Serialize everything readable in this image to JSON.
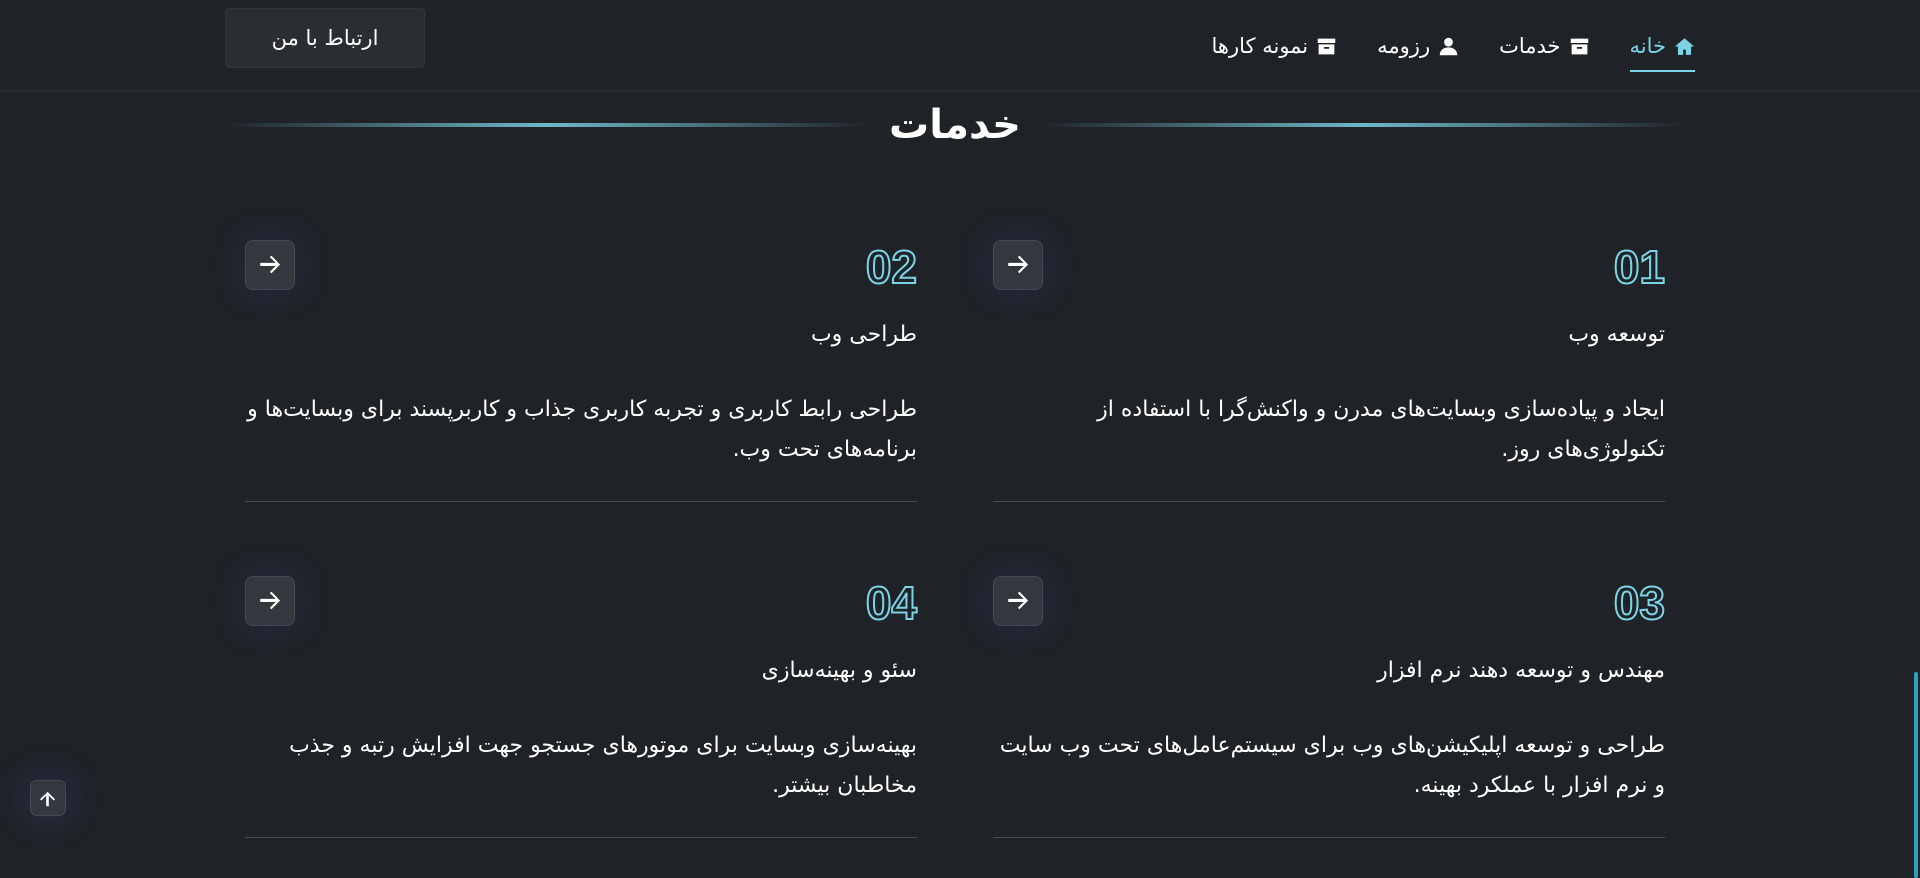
{
  "nav": {
    "items": [
      {
        "label": "خانه",
        "icon": "home-icon",
        "active": true
      },
      {
        "label": "خدمات",
        "icon": "archive-icon",
        "active": false
      },
      {
        "label": "رزومه",
        "icon": "user-icon",
        "active": false
      },
      {
        "label": "نمونه کارها",
        "icon": "archive-icon",
        "active": false
      }
    ],
    "contact_label": "ارتباط با من"
  },
  "section": {
    "title": "خدمات"
  },
  "services": [
    {
      "number": "01",
      "title": "توسعه وب",
      "description": "ایجاد و پیاده‌سازی وبسایت‌های مدرن و واکنش‌گرا با استفاده از تکنولوژی‌های روز."
    },
    {
      "number": "02",
      "title": "طراحی وب",
      "description": "طراحی رابط کاربری و تجربه کاربری جذاب و کاربرپسند برای وبسایت‌ها و برنامه‌های تحت وب."
    },
    {
      "number": "03",
      "title": "مهندس و توسعه دهند نرم افزار",
      "description": "طراحی و توسعه اپلیکیشن‌های وب برای سیستم‌عامل‌های تحت وب سایت و نرم افزار با عملکرد بهینه."
    },
    {
      "number": "04",
      "title": "سئو و بهینه‌سازی",
      "description": "بهینه‌سازی وبسایت برای موتورهای جستجو جهت افزایش رتبه و جذب مخاطبان بیشتر."
    }
  ],
  "colors": {
    "background": "#1f2226",
    "accent": "#7dd3e6",
    "button_bg": "#33383e"
  },
  "icons": {
    "card_action": "arrow-right-icon",
    "back_to_top": "arrow-up-icon"
  }
}
